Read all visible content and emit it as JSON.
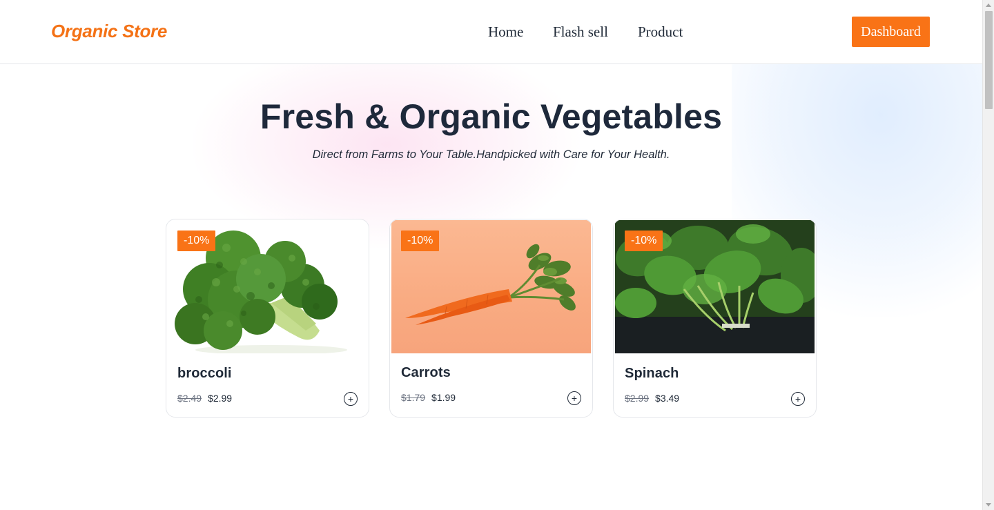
{
  "header": {
    "brand": "Organic Store",
    "nav": [
      {
        "label": "Home"
      },
      {
        "label": "Flash sell"
      },
      {
        "label": "Product"
      }
    ],
    "dashboard_label": "Dashboard"
  },
  "hero": {
    "title": "Fresh & Organic Vegetables",
    "subtitle": "Direct from Farms to Your Table.Handpicked with Care for Your Health."
  },
  "products": [
    {
      "name": "broccoli",
      "badge": "-10%",
      "old_price": "$2.49",
      "price": "$2.99",
      "add_icon": "plus-circle-icon"
    },
    {
      "name": "Carrots",
      "badge": "-10%",
      "old_price": "$1.79",
      "price": "$1.99",
      "add_icon": "plus-circle-icon"
    },
    {
      "name": "Spinach",
      "badge": "-10%",
      "old_price": "$2.99",
      "price": "$3.49",
      "add_icon": "plus-circle-icon"
    }
  ],
  "colors": {
    "accent": "#f97316",
    "brand_text": "#f47216",
    "text": "#1f2937"
  }
}
